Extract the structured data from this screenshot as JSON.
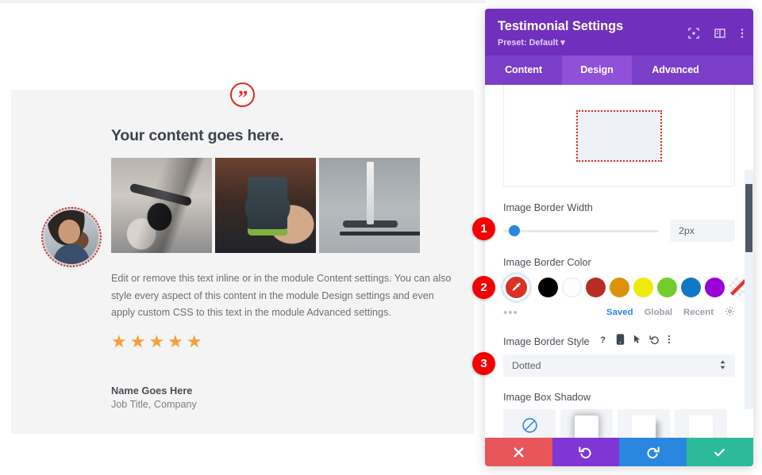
{
  "testimonial": {
    "quote_icon": "quote-mark-icon",
    "avatar_alt": "person-avatar",
    "headline": "Your content goes here.",
    "body": "Edit or remove this text inline or in the module Content settings. You can also style every aspect of this content in the module Design settings and even apply custom CSS to this text in the module Advanced settings.",
    "rating_stars": "★★★★★",
    "author_name": "Name Goes Here",
    "author_title": "Job Title, Company",
    "images": [
      {
        "name": "scooter-handlebar-photo"
      },
      {
        "name": "phone-in-hands-photo"
      },
      {
        "name": "person-riding-scooter-photo"
      }
    ]
  },
  "panel": {
    "title": "Testimonial Settings",
    "preset": "Preset: Default ▾",
    "header_icons": [
      {
        "name": "focus-icon"
      },
      {
        "name": "layout-panel-icon"
      },
      {
        "name": "more-vertical-icon"
      }
    ],
    "tabs": [
      {
        "label": "Content",
        "active": false
      },
      {
        "label": "Design",
        "active": true
      },
      {
        "label": "Advanced",
        "active": false
      }
    ],
    "border_width": {
      "label": "Image Border Width",
      "value": "2px",
      "slider_percent": 4
    },
    "border_color": {
      "label": "Image Border Color",
      "picker_icon": "eyedropper-icon",
      "picker_color": "#db3024",
      "swatches": [
        {
          "name": "swatch-black",
          "color": "#000000"
        },
        {
          "name": "swatch-white",
          "color": "#fdfdfd"
        },
        {
          "name": "swatch-red",
          "color": "#b82d21"
        },
        {
          "name": "swatch-orange",
          "color": "#dd9209"
        },
        {
          "name": "swatch-yellow",
          "color": "#eeea0a"
        },
        {
          "name": "swatch-green",
          "color": "#73cc2b"
        },
        {
          "name": "swatch-blue",
          "color": "#1277c4"
        },
        {
          "name": "swatch-purple",
          "color": "#9b00d9"
        }
      ],
      "none_swatch": "swatch-transparent",
      "more_dots": "•••",
      "tabs": [
        {
          "label": "Saved",
          "active": true
        },
        {
          "label": "Global",
          "active": false
        },
        {
          "label": "Recent",
          "active": false
        }
      ],
      "settings_icon": "gear-icon"
    },
    "border_style": {
      "label": "Image Border Style",
      "value": "Dotted",
      "icons": [
        {
          "name": "help-icon"
        },
        {
          "name": "mobile-device-icon"
        },
        {
          "name": "hover-cursor-icon"
        },
        {
          "name": "reset-icon"
        },
        {
          "name": "more-vertical-icon"
        }
      ]
    },
    "box_shadow": {
      "label": "Image Box Shadow",
      "presets": [
        {
          "name": "shadow-preset-none"
        },
        {
          "name": "shadow-preset-glow"
        },
        {
          "name": "shadow-preset-offset"
        },
        {
          "name": "shadow-preset-bottom"
        }
      ]
    },
    "footer": [
      {
        "name": "cancel-button",
        "icon": "close-icon",
        "color": "#e8555a"
      },
      {
        "name": "undo-button",
        "icon": "undo-icon",
        "color": "#7f36d4"
      },
      {
        "name": "redo-button",
        "icon": "redo-icon",
        "color": "#2a87e0"
      },
      {
        "name": "save-button",
        "icon": "checkmark-icon",
        "color": "#2cba9b"
      }
    ]
  },
  "step_badges": [
    {
      "number": "1"
    },
    {
      "number": "2"
    },
    {
      "number": "3"
    }
  ]
}
